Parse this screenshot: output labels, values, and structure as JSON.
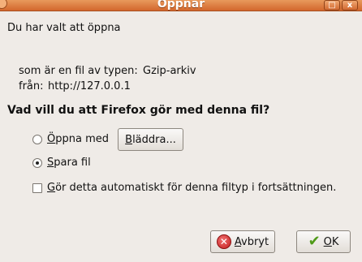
{
  "window": {
    "title": "Öppnar",
    "controls": {
      "minimize": "_",
      "maximize": "□",
      "close": "x"
    }
  },
  "dialog": {
    "intro": "Du har valt att öppna",
    "filename": "",
    "type_label": "som är en fil av typen:",
    "type_value": "Gzip-arkiv",
    "from_label": "från:",
    "from_value": "http://127.0.0.1",
    "question": "Vad vill du att Firefox gör med denna fil?",
    "options": {
      "open_with": {
        "label": "Öppna med",
        "checked": false
      },
      "browse_button": "Bläddra...",
      "save_file": {
        "label": "Spara fil",
        "checked": true
      },
      "auto_checkbox": {
        "label": "Gör detta automatiskt för denna filtyp i fortsättningen.",
        "checked": false
      }
    },
    "buttons": {
      "cancel": "Avbryt",
      "ok": "OK"
    }
  },
  "icons": {
    "cancel": "cancel-icon",
    "ok": "ok-check-icon"
  }
}
